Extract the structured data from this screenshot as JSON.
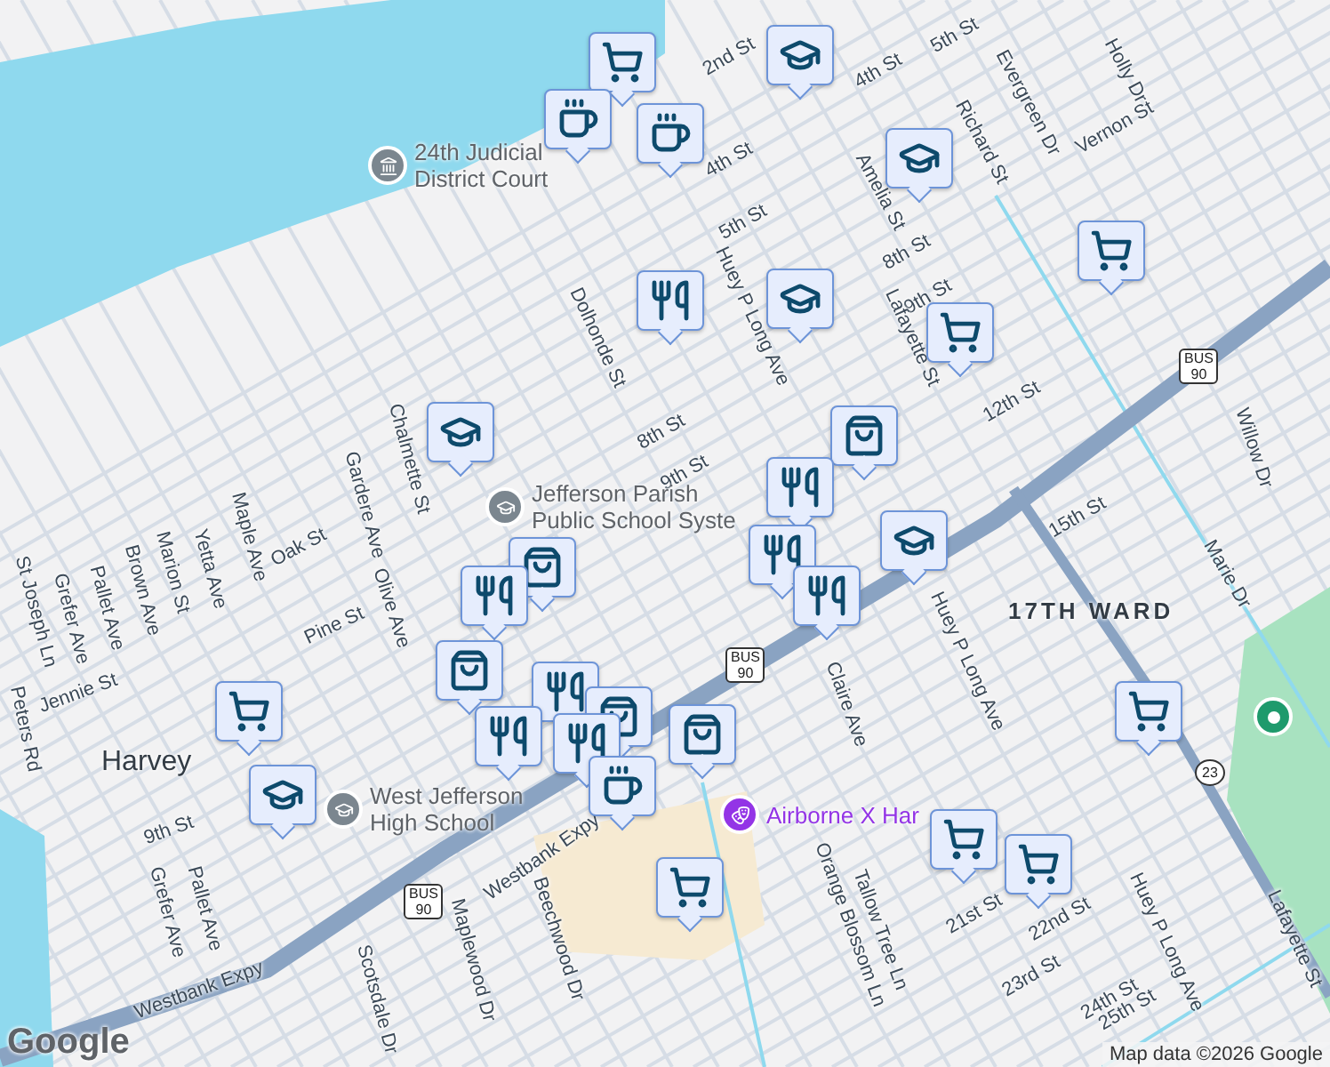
{
  "map": {
    "places": [
      {
        "name": "24th Judicial\nDistrict Court",
        "kind": "civic"
      },
      {
        "name": "Jefferson Parish\nPublic School Syste",
        "kind": "school"
      },
      {
        "name": "West Jefferson\nHigh School",
        "kind": "school"
      },
      {
        "name": "Airborne X Har",
        "kind": "venue"
      }
    ],
    "areas": [
      "Harvey",
      "17TH WARD"
    ],
    "streets": [
      "5th St",
      "5th St",
      "4th St",
      "2nd St",
      "4th St",
      "Richard St",
      "Evergreen Dr",
      "Holly Dr",
      "Vernon St",
      "Amelia St",
      "8th St",
      "9th St",
      "12th St",
      "Lafayette St",
      "Huey P Long Ave",
      "Dolhonde St",
      "8th St",
      "9th St",
      "Chalmette St",
      "Gardere Ave",
      "Maple Ave",
      "Oak St",
      "Marion St",
      "Yetta Ave",
      "Brown Ave",
      "Pallet Ave",
      "Grefer Ave",
      "St Joseph Ln",
      "Olive Ave",
      "Pine St",
      "Jennie St",
      "Peters Rd",
      "9th St",
      "Grefer Ave",
      "Pallet Ave",
      "Westbank Expy",
      "Westbank Expy",
      "Beechwood Dr",
      "Maplewood Dr",
      "Scotsdale Dr",
      "Claire Ave",
      "Huey P Long Ave",
      "15th St",
      "Marie Dr",
      "Tallow Tree Ln",
      "Orange Blossom Ln",
      "21st St",
      "22nd St",
      "23rd St",
      "24th St",
      "25th St",
      "Huey P Long Ave",
      "Lafayette St",
      "Willow Dr"
    ],
    "shields": [
      {
        "kind": "us",
        "top": "BUS",
        "number": "90"
      },
      {
        "kind": "us",
        "top": "BUS",
        "number": "90"
      },
      {
        "kind": "us",
        "top": "BUS",
        "number": "90"
      },
      {
        "kind": "state",
        "number": "23"
      }
    ],
    "markers": [
      {
        "kind": "cart"
      },
      {
        "kind": "cup"
      },
      {
        "kind": "cup"
      },
      {
        "kind": "school"
      },
      {
        "kind": "school"
      },
      {
        "kind": "cart"
      },
      {
        "kind": "fork"
      },
      {
        "kind": "school"
      },
      {
        "kind": "cart"
      },
      {
        "kind": "bag"
      },
      {
        "kind": "school"
      },
      {
        "kind": "fork"
      },
      {
        "kind": "bag"
      },
      {
        "kind": "fork"
      },
      {
        "kind": "fork"
      },
      {
        "kind": "school"
      },
      {
        "kind": "fork"
      },
      {
        "kind": "bag"
      },
      {
        "kind": "fork"
      },
      {
        "kind": "bag"
      },
      {
        "kind": "fork"
      },
      {
        "kind": "fork"
      },
      {
        "kind": "bag"
      },
      {
        "kind": "cup"
      },
      {
        "kind": "cart"
      },
      {
        "kind": "school"
      },
      {
        "kind": "cart"
      },
      {
        "kind": "cart"
      },
      {
        "kind": "cart"
      },
      {
        "kind": "cart"
      },
      {
        "kind": "park"
      }
    ]
  },
  "attribution": {
    "logo": "Google",
    "text": "Map data ©2026 Google"
  }
}
